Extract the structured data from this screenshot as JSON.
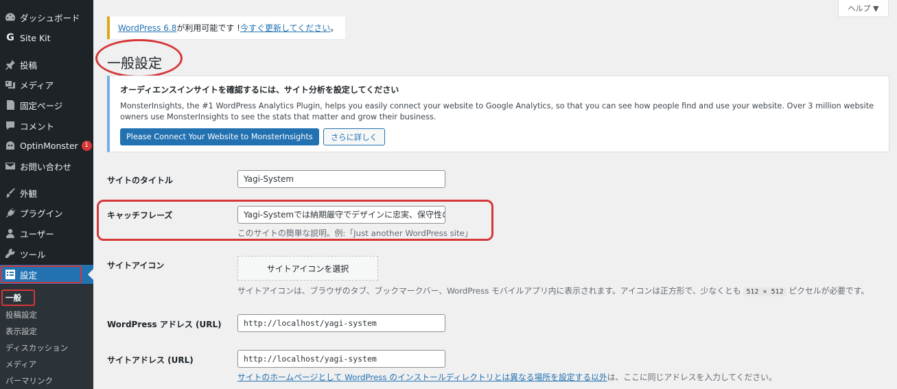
{
  "sidebar": {
    "items": [
      {
        "label": "ダッシュボード",
        "icon": "dashboard-icon"
      },
      {
        "label": "Site Kit",
        "icon": "sitekit-icon"
      },
      {
        "label": "投稿",
        "icon": "pin-icon"
      },
      {
        "label": "メディア",
        "icon": "media-icon"
      },
      {
        "label": "固定ページ",
        "icon": "page-icon"
      },
      {
        "label": "コメント",
        "icon": "comment-icon"
      },
      {
        "label": "OptinMonster",
        "icon": "optinmonster-icon",
        "badge": "1"
      },
      {
        "label": "お問い合わせ",
        "icon": "mail-icon"
      },
      {
        "label": "外観",
        "icon": "brush-icon"
      },
      {
        "label": "プラグイン",
        "icon": "plugin-icon"
      },
      {
        "label": "ユーザー",
        "icon": "user-icon"
      },
      {
        "label": "ツール",
        "icon": "wrench-icon"
      },
      {
        "label": "設定",
        "icon": "settings-icon",
        "active": true
      }
    ],
    "submenu": [
      "一般",
      "投稿設定",
      "表示設定",
      "ディスカッション",
      "メディア",
      "パーマリンク"
    ],
    "active_color": "#2271b1",
    "highlight_color": "#d63638"
  },
  "help_tab": {
    "label": "ヘルプ ▼"
  },
  "update_notice": {
    "version_link": "WordPress 6.8",
    "middle_text": " が利用可能です ! ",
    "update_link": "今すぐ更新してください",
    "end_text": "。"
  },
  "page_title": "一般設定",
  "monsterinsights": {
    "heading": "オーディエンスインサイトを確認するには、サイト分析を設定してください",
    "body": "MonsterInsights, the #1 WordPress Analytics Plugin, helps you easily connect your website to Google Analytics, so that you can see how people find and use your website. Over 3 million website owners use MonsterInsights to see the stats that matter and grow their business.",
    "primary_button": "Please Connect Your Website to MonsterInsights",
    "secondary_button": "さらに詳しく"
  },
  "form": {
    "site_title": {
      "label": "サイトのタイトル",
      "value": "Yagi-System"
    },
    "tagline": {
      "label": "キャッチフレーズ",
      "value": "Yagi-Systemでは納期厳守でデザインに忠実、保守性の",
      "description": "このサイトの簡単な説明。例:「Just another WordPress site」"
    },
    "site_icon": {
      "label": "サイトアイコン",
      "button": "サイトアイコンを選択",
      "description_before": "サイトアイコンは、ブラウザのタブ、ブックマークバー、WordPress モバイルアプリ内に表示されます。アイコンは正方形で、少なくとも ",
      "size_code": "512 × 512",
      "description_after": " ピクセルが必要です。"
    },
    "wp_address": {
      "label": "WordPress アドレス (URL)",
      "value": "http://localhost/yagi-system"
    },
    "site_address": {
      "label": "サイトアドレス (URL)",
      "value": "http://localhost/yagi-system",
      "description_link": "サイトのホームページとして WordPress のインストールディレクトリとは異なる場所を設定する以外",
      "description_after": "は、ここに同じアドレスを入力してください。"
    }
  }
}
